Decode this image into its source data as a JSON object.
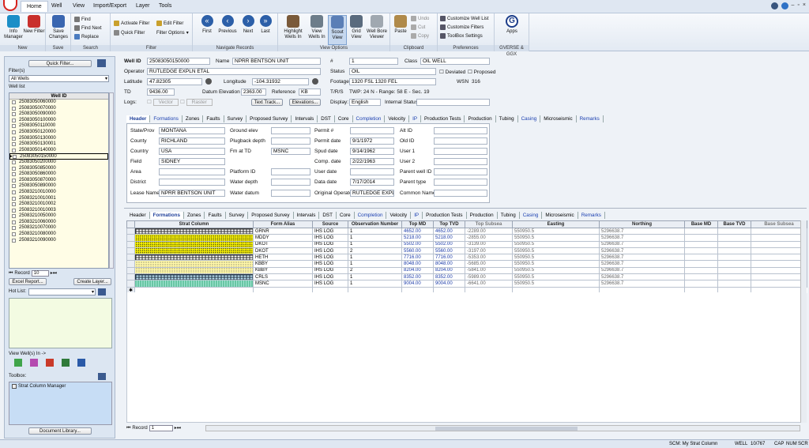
{
  "menu": {
    "items": [
      "Home",
      "Well",
      "View",
      "Import/Export",
      "Layer",
      "Tools"
    ]
  },
  "ribbon": {
    "new": {
      "label": "New",
      "info_manager": "Info Manager",
      "new_filter": "New Filter"
    },
    "save": {
      "label": "Save",
      "save_changes": "Save Changes"
    },
    "search": {
      "label": "Search",
      "find": "Find",
      "find_next": "Find Next",
      "replace": "Replace"
    },
    "filter": {
      "label": "Filter",
      "activate": "Activate Filter",
      "quick": "Quick Filter",
      "edit": "Edit Filter",
      "options": "Filter Options"
    },
    "navigate": {
      "label": "Navigate Records",
      "first": "First",
      "previous": "Previous",
      "next": "Next",
      "last": "Last"
    },
    "view_options": {
      "label": "View Options",
      "highlight": "Highlight Wells In",
      "view": "View Wells In",
      "scout": "Scout View",
      "grid": "Grid View",
      "wellbore": "Well Bore Viewer"
    },
    "clipboard": {
      "label": "Clipboard",
      "paste": "Paste",
      "undo": "Undo",
      "cut": "Cut",
      "copy": "Copy"
    },
    "preferences": {
      "label": "Preferences",
      "cust_well_list": "Customize Well List",
      "cust_filters": "Customize Filters",
      "toolbox_settings": "ToolBox Settings"
    },
    "apps": {
      "label": "GVERSE & GGX",
      "apps": "Apps"
    }
  },
  "left": {
    "quick_filter": "Quick Filter...",
    "filters_label": "Filter(s)",
    "filter_value": "All Wells",
    "well_list_label": "Well list",
    "well_id_header": "Well ID",
    "wells": [
      "25083050060000",
      "25083050070000",
      "25083050090000",
      "25083050100000",
      "25083050110000",
      "25083050120000",
      "25083050130000",
      "25083050130001",
      "25083050140000",
      "25083050150000",
      "25083050200000",
      "25083050850000",
      "25083050860000",
      "25083050870000",
      "25083050890000",
      "25083210010000",
      "25083210010001",
      "25083210010002",
      "25083210010003",
      "25083210050000",
      "25083210060000",
      "25083210070000",
      "25083210080000",
      "25083210090000"
    ],
    "record_label": "Record",
    "record_value": "10",
    "excel_report": "Excel Report...",
    "create_layer": "Create Layer...",
    "hot_list_label": "Hot List:",
    "view_wells_in": "View Well(s) In ->",
    "toolbox_label": "Toolbox:",
    "strat_manager": "Strat Column Manager",
    "doc_library": "Document Library..."
  },
  "well": {
    "well_id_label": "Well ID",
    "well_id": "25083050150000",
    "name_label": "Name",
    "name": "NPRR BENTSON UNIT",
    "num_label": "#",
    "num": "1",
    "class_label": "Class",
    "class": "OIL WELL",
    "operator_label": "Operator",
    "operator": "RUTLEDGE EXPLN ETAL",
    "status_label": "Status",
    "status": "OIL",
    "deviated": "Deviated",
    "proposed": "Proposed",
    "lat_label": "Latitude",
    "lat": "47.82305",
    "lon_label": "Longitude",
    "lon": "-104.31932",
    "footage_label": "Footage",
    "footage": "1320 FSL 1320 FEL",
    "wsn_label": "WSN",
    "wsn": "316",
    "td_label": "TD",
    "td": "9436.00",
    "datum_label": "Datum Elevation",
    "datum": "2363.00",
    "ref_label": "Reference",
    "ref": "KB",
    "trs_label": "T/R/S",
    "trs": "TWP: 24 N - Range: 58 E - Sec. 19",
    "logs_label": "Logs:",
    "vector": "Vector",
    "raster": "Raster",
    "text_track": "Text Track...",
    "elevations": "Elevations...",
    "display_label": "Display:",
    "display": "English",
    "internal_status_label": "Internal Status",
    "internal_status": ""
  },
  "tabs": [
    "Header",
    "Formations",
    "Zones",
    "Faults",
    "Survey",
    "Proposed Survey",
    "Intervals",
    "DST",
    "Core",
    "Completion",
    "Velocity",
    "IP",
    "Production Tests",
    "Production",
    "Tubing",
    "Casing",
    "Microseismic",
    "Remarks"
  ],
  "header": {
    "state_label": "State/Prov",
    "state": "MONTANA",
    "county_label": "County",
    "county": "RICHLAND",
    "country_label": "Country",
    "country": "USA",
    "field_label": "Field",
    "field": "SIDNEY",
    "area_label": "Area",
    "area": "",
    "district_label": "District",
    "district": "",
    "lease_label": "Lease Name",
    "lease": "NPRR BENTSON UNIT",
    "ground_label": "Ground elev",
    "ground": "",
    "plugback_label": "Plugback depth",
    "plugback": "",
    "fm_td_label": "Fm at TD",
    "fm_td": "MSNC",
    "platform_label": "Platform ID",
    "platform": "",
    "water_depth_label": "Water depth",
    "water_depth": "",
    "water_datum_label": "Water datum",
    "water_datum": "",
    "permit_num_label": "Permit #",
    "permit_num": "",
    "permit_date_label": "Permit date",
    "permit_date": "9/1/1972",
    "spud_label": "Spud date",
    "spud": "9/14/1962",
    "comp_label": "Comp. date",
    "comp": "2/22/1963",
    "user_date_label": "User date",
    "user_date": "",
    "data_date_label": "Data date",
    "data_date": "7/17/2014",
    "orig_op_label": "Original Operator",
    "orig_op": "RUTLEDGE EXPLN",
    "alt_id_label": "Alt ID",
    "alt_id": "",
    "old_id_label": "Old ID",
    "old_id": "",
    "user1_label": "User 1",
    "user1": "",
    "user2_label": "User 2",
    "user2": "",
    "parent_label": "Parent well ID",
    "parent": "",
    "parent_type_label": "Parent type",
    "parent_type": "",
    "common_label": "Common Name",
    "common": ""
  },
  "formations": {
    "columns": [
      "Strat Column",
      "Form Alias",
      "Source",
      "Observation Number",
      "Top MD",
      "Top TVD",
      "Top Subsea",
      "Easting",
      "Northing",
      "Base MD",
      "Base TVD",
      "Base Subsea"
    ],
    "rows": [
      {
        "pattern": "brick",
        "alias": "GRNR",
        "source": "IHS LOG",
        "obs": "1",
        "top_md": "4652.00",
        "top_tvd": "4652.00",
        "top_ss": "-2289.00",
        "east": "550950.5",
        "north": "5296638.7"
      },
      {
        "pattern": "dot-yellow",
        "alias": "MDDY",
        "source": "IHS LOG",
        "obs": "1",
        "top_md": "5218.00",
        "top_tvd": "5218.00",
        "top_ss": "-2855.00",
        "east": "550950.5",
        "north": "5296638.7"
      },
      {
        "pattern": "dot-yellow",
        "alias": "DKOT",
        "source": "IHS LOG",
        "obs": "1",
        "top_md": "5502.00",
        "top_tvd": "5502.00",
        "top_ss": "-3139.00",
        "east": "550950.5",
        "north": "5296638.7"
      },
      {
        "pattern": "dot-yellow",
        "alias": "DKOT",
        "source": "IHS LOG",
        "obs": "2",
        "top_md": "5560.00",
        "top_tvd": "5560.00",
        "top_ss": "-3197.00",
        "east": "550950.5",
        "north": "5296638.7"
      },
      {
        "pattern": "brick",
        "alias": "HETH",
        "source": "IHS LOG",
        "obs": "1",
        "top_md": "7716.00",
        "top_tvd": "7716.00",
        "top_ss": "-5353.00",
        "east": "550950.5",
        "north": "5296638.7"
      },
      {
        "pattern": "dot-light",
        "alias": "KBBY",
        "source": "IHS LOG",
        "obs": "1",
        "top_md": "8048.00",
        "top_tvd": "8048.00",
        "top_ss": "-5685.00",
        "east": "550950.5",
        "north": "5296638.7"
      },
      {
        "pattern": "dot-light",
        "alias": "KBBY",
        "source": "IHS LOG",
        "obs": "2",
        "top_md": "8204.00",
        "top_tvd": "8204.00",
        "top_ss": "-5841.00",
        "east": "550950.5",
        "north": "5296638.7"
      },
      {
        "pattern": "brick-blue",
        "alias": "CRLS",
        "source": "IHS LOG",
        "obs": "1",
        "top_md": "8352.00",
        "top_tvd": "8352.00",
        "top_ss": "-5989.00",
        "east": "550950.5",
        "north": "5296638.7"
      },
      {
        "pattern": "lime",
        "alias": "MSNC",
        "source": "IHS LOG",
        "obs": "1",
        "top_md": "9004.00",
        "top_tvd": "9004.00",
        "top_ss": "-6641.00",
        "east": "550950.5",
        "north": "5296638.7"
      }
    ],
    "record_label": "Record",
    "record_value": "1"
  },
  "status": {
    "scm": "SCM: My Strat Column",
    "well": "WELL",
    "count": "10/767",
    "cap": "CAP",
    "num": "NUM",
    "scr": "SCR"
  }
}
